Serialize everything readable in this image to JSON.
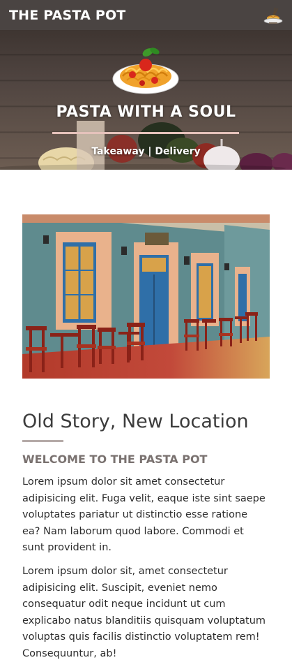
{
  "navbar": {
    "brand": "THE PASTA POT",
    "menu_icon": "pasta-dish-icon"
  },
  "hero": {
    "title": "PASTA WITH A SOUL",
    "subtitle": "Takeaway | Delivery"
  },
  "about": {
    "heading": "Old Story, New Location",
    "subheading": "WELCOME TO THE PASTA POT",
    "paragraphs": [
      "Lorem ipsum dolor sit amet consectetur adipisicing elit. Fuga velit, eaque iste sint saepe voluptates pariatur ut distinctio esse ratione ea? Nam laborum quod labore. Commodi et sunt provident in.",
      "Lorem ipsum dolor sit, amet consectetur adipisicing elit. Suscipit, eveniet nemo consequatur odit neque incidunt ut cum explicabo natus blanditiis quisquam voluptatum voluptas quis facilis distinctio voluptatem rem! Consequuntur, ab!"
    ]
  },
  "colors": {
    "navbar_bg": "#4a4442",
    "hero_rule": "#e5c2bb",
    "section_rule": "#b5aaa8",
    "subheading": "#7a7270"
  }
}
